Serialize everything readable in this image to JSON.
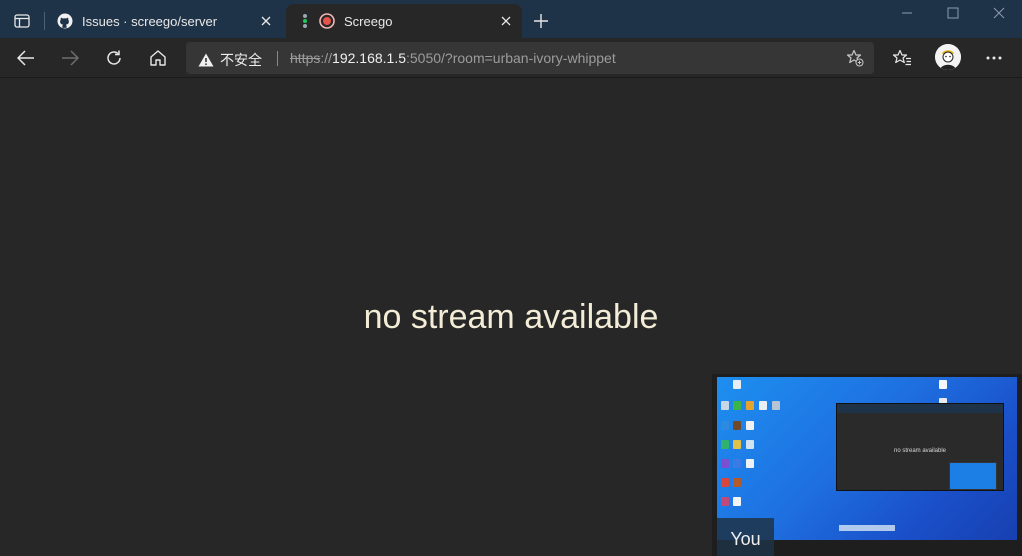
{
  "tabs": [
    {
      "label": "Issues · screego/server",
      "favicon": "github-icon"
    },
    {
      "label": "Screego",
      "favicon": "record-icon"
    }
  ],
  "address": {
    "security_label": "不安全",
    "url_scheme": "https",
    "url_sep": "://",
    "url_host": "192.168.1.5",
    "url_rest": ":5050/?room=urban-ivory-whippet"
  },
  "main": {
    "message": "no stream available",
    "self_label": "You"
  },
  "preview": {
    "mini_message": "no stream available"
  },
  "colors": {
    "titlebar": "#1f3348",
    "page_bg": "#272727",
    "message_text": "#f3ecd6"
  }
}
